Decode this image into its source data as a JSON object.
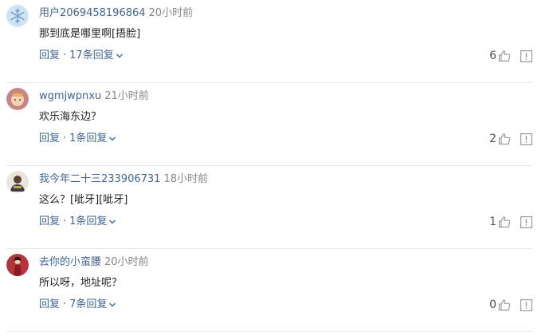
{
  "comments": [
    {
      "username": "用户2069458196864",
      "time": "20小时前",
      "text": "那到底是哪里啊[捂脸]",
      "reply_label": "回复",
      "separator": "·",
      "replies_label": "17条回复",
      "likes": "6",
      "avatar": "snowflake-avatar"
    },
    {
      "username": "wgmjwpnxu",
      "time": "21小时前",
      "text": "欢乐海东边？",
      "reply_label": "回复",
      "separator": "·",
      "replies_label": "1条回复",
      "likes": "2",
      "avatar": "pink-cartoon-avatar"
    },
    {
      "username": "我今年二十三233906731",
      "time": "18小时前",
      "text": "这么？[呲牙][呲牙]",
      "reply_label": "回复",
      "separator": "·",
      "replies_label": "1条回复",
      "likes": "1",
      "avatar": "person-photo-avatar"
    },
    {
      "username": "去你的小蛮腰",
      "time": "20小时前",
      "text": "所以呀，地址呢？",
      "reply_label": "回复",
      "separator": "·",
      "replies_label": "7条回复",
      "likes": "0",
      "avatar": "red-dress-avatar"
    }
  ],
  "colors": {
    "link": "#406599",
    "muted": "#888888",
    "icon": "#999999"
  }
}
